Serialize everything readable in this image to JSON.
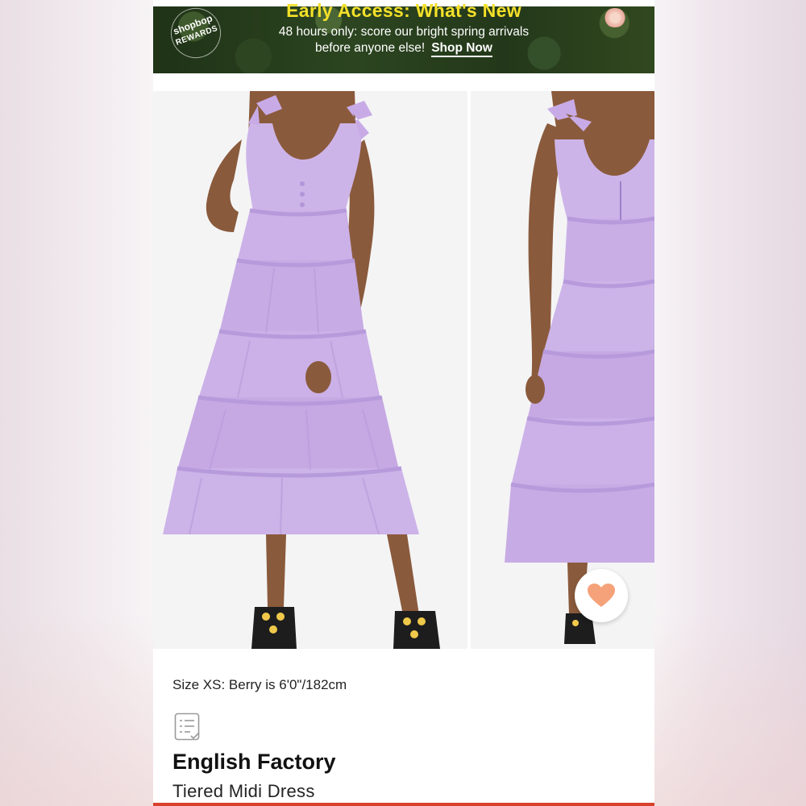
{
  "banner": {
    "badge_top": "shopbop",
    "badge_bottom": "REWARDS",
    "title": "Early Access: What's New",
    "line1": "48 hours only: score our bright spring arrivals",
    "line2": "before anyone else!",
    "cta_label": "Shop Now"
  },
  "product": {
    "size_note": "Size XS: Berry is 6'0\"/182cm",
    "brand": "English Factory",
    "name": "Tiered Midi Dress"
  },
  "icons": {
    "favorite": "heart-icon",
    "details": "details-list-icon"
  },
  "colors": {
    "banner_title": "#f4e02a",
    "dress": "#c9aee6",
    "heart": "#f5a27a",
    "accent_bar": "#d9412e"
  }
}
